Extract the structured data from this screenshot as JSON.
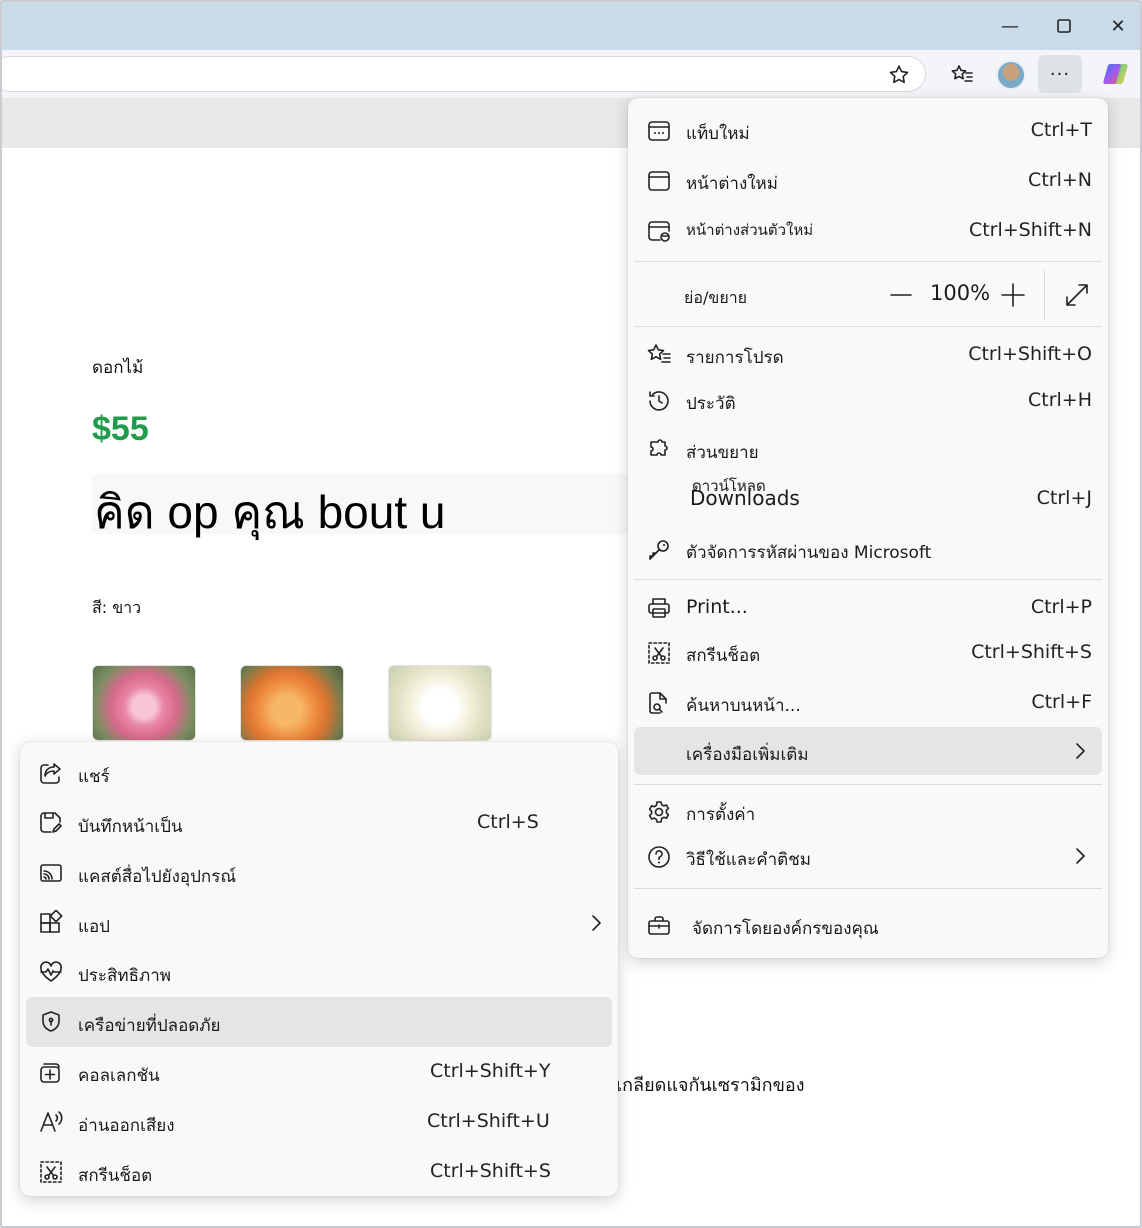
{
  "window": {
    "minimize_glyph": "—",
    "maximize_glyph": "☐",
    "close_glyph": "✕"
  },
  "toolbar": {
    "more_glyph": "···"
  },
  "product": {
    "category": "ดอกไม้",
    "price": "$55",
    "title": "คิด op คุณ bout u",
    "color_label": "สี: ขาว",
    "description_fragment": "เกลียดแจกันเซรามิกของ"
  },
  "main_menu": {
    "new_tab": {
      "label": "แท็บใหม่",
      "shortcut": "Ctrl+T"
    },
    "new_window": {
      "label": "หน้าต่างใหม่",
      "shortcut": "Ctrl+N"
    },
    "new_private": {
      "label": "หน้าต่างส่วนตัวใหม่",
      "shortcut": "Ctrl+Shift+N"
    },
    "zoom": {
      "label": "ย่อ/ขยาย",
      "value": "100%"
    },
    "favorites": {
      "label": "รายการโปรด",
      "shortcut": "Ctrl+Shift+O"
    },
    "history": {
      "label": "ประวัติ",
      "shortcut": "Ctrl+H"
    },
    "extensions": {
      "label": "ส่วนขยาย"
    },
    "downloads": {
      "label_thai": "ดาวน์โหลด",
      "label_en": "Downloads",
      "shortcut": "Ctrl+J"
    },
    "passwords": {
      "label": "ตัวจัดการรหัสผ่านของ Microsoft"
    },
    "print": {
      "label": "Print...",
      "shortcut": "Ctrl+P"
    },
    "screenshot": {
      "label": "สกรีนช็อต",
      "shortcut": "Ctrl+Shift+S"
    },
    "find": {
      "label": "ค้นหาบนหน้า...",
      "shortcut": "Ctrl+F"
    },
    "more_tools": {
      "label": "เครื่องมือเพิ่มเติม"
    },
    "settings": {
      "label": "การตั้งค่า"
    },
    "help": {
      "label": "วิธีใช้และคำติชม"
    },
    "org": {
      "label": "จัดการโดยองค์กรของคุณ"
    }
  },
  "sub_menu": {
    "share": {
      "label": "แชร์"
    },
    "save_as": {
      "label": "บันทึกหน้าเป็น",
      "shortcut": "Ctrl+S"
    },
    "cast": {
      "label": "แคสต์สื่อไปยังอุปกรณ์"
    },
    "apps": {
      "label": "แอป"
    },
    "performance": {
      "label": "ประสิทธิภาพ"
    },
    "secure_network": {
      "label": "เครือข่ายที่ปลอดภัย"
    },
    "collections": {
      "label": "คอลเลกชัน",
      "shortcut": "Ctrl+Shift+Y"
    },
    "read_aloud": {
      "label": "อ่านออกเสียง",
      "shortcut": "Ctrl+Shift+U"
    },
    "screenshot": {
      "label": "สกรีนช็อต",
      "shortcut": "Ctrl+Shift+S"
    }
  },
  "colors": {
    "price_green": "#1f9b4a",
    "titlebar": "#c9dbe8",
    "menu_bg": "#f9f9f9",
    "highlight": "#e5e5e5"
  }
}
